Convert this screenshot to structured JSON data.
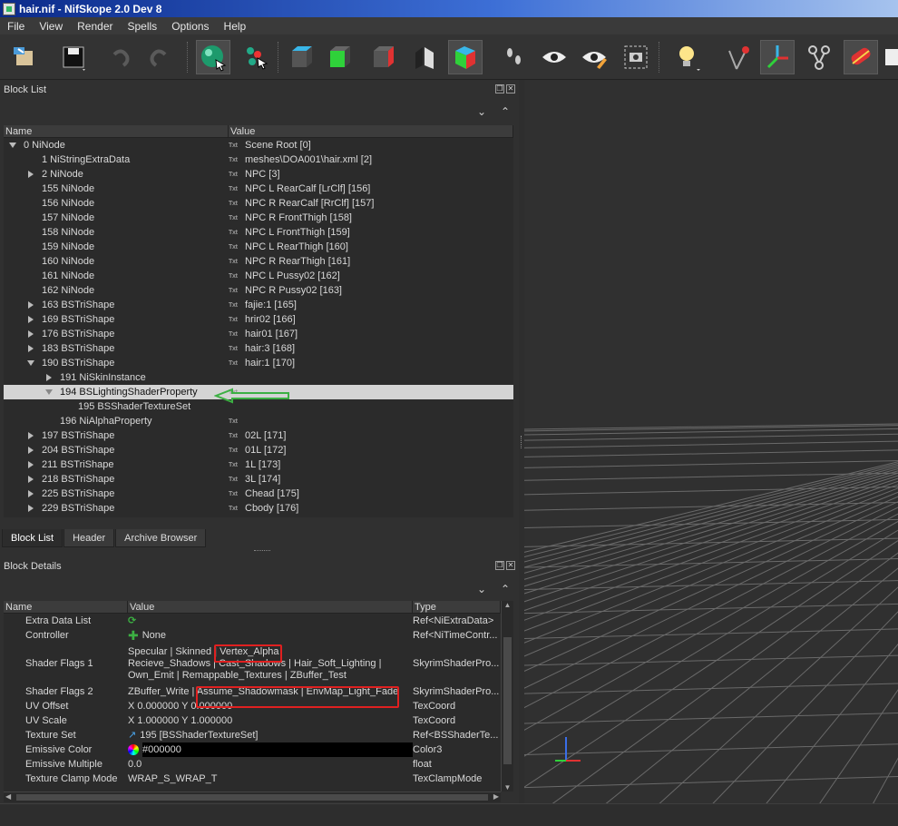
{
  "window": {
    "title": "hair.nif - NifSkope 2.0 Dev 8"
  },
  "menu": [
    "File",
    "View",
    "Render",
    "Spells",
    "Options",
    "Help"
  ],
  "block_list": {
    "title": "Block List",
    "columns": [
      "Name",
      "Value"
    ],
    "rows": [
      {
        "name": "0 NiNode",
        "value": "Scene Root [0]",
        "indent": 0,
        "arrow": "down"
      },
      {
        "name": "1 NiStringExtraData",
        "value": "meshes\\DOA001\\hair.xml [2]",
        "indent": 1,
        "arrow": ""
      },
      {
        "name": "2 NiNode",
        "value": "NPC [3]",
        "indent": 1,
        "arrow": "right"
      },
      {
        "name": "155 NiNode",
        "value": "NPC L RearCalf [LrClf] [156]",
        "indent": 1,
        "arrow": ""
      },
      {
        "name": "156 NiNode",
        "value": "NPC R RearCalf [RrClf] [157]",
        "indent": 1,
        "arrow": ""
      },
      {
        "name": "157 NiNode",
        "value": "NPC R FrontThigh [158]",
        "indent": 1,
        "arrow": ""
      },
      {
        "name": "158 NiNode",
        "value": "NPC L FrontThigh [159]",
        "indent": 1,
        "arrow": ""
      },
      {
        "name": "159 NiNode",
        "value": "NPC L RearThigh [160]",
        "indent": 1,
        "arrow": ""
      },
      {
        "name": "160 NiNode",
        "value": "NPC R RearThigh [161]",
        "indent": 1,
        "arrow": ""
      },
      {
        "name": "161 NiNode",
        "value": "NPC L Pussy02 [162]",
        "indent": 1,
        "arrow": ""
      },
      {
        "name": "162 NiNode",
        "value": "NPC R Pussy02 [163]",
        "indent": 1,
        "arrow": ""
      },
      {
        "name": "163 BSTriShape",
        "value": "fajie:1 [165]",
        "indent": 1,
        "arrow": "right"
      },
      {
        "name": "169 BSTriShape",
        "value": "hrir02 [166]",
        "indent": 1,
        "arrow": "right"
      },
      {
        "name": "176 BSTriShape",
        "value": "hair01 [167]",
        "indent": 1,
        "arrow": "right"
      },
      {
        "name": "183 BSTriShape",
        "value": "hair:3 [168]",
        "indent": 1,
        "arrow": "right"
      },
      {
        "name": "190 BSTriShape",
        "value": "hair:1 [170]",
        "indent": 1,
        "arrow": "down"
      },
      {
        "name": "191 NiSkinInstance",
        "value": "",
        "indent": 2,
        "arrow": "right"
      },
      {
        "name": "194 BSLightingShaderProperty",
        "value": "",
        "indent": 2,
        "arrow": "down",
        "selected": true
      },
      {
        "name": "195 BSShaderTextureSet",
        "value": "",
        "indent": 3,
        "arrow": ""
      },
      {
        "name": "196 NiAlphaProperty",
        "value": "",
        "indent": 2,
        "arrow": ""
      },
      {
        "name": "197 BSTriShape",
        "value": "02L [171]",
        "indent": 1,
        "arrow": "right"
      },
      {
        "name": "204 BSTriShape",
        "value": "01L [172]",
        "indent": 1,
        "arrow": "right"
      },
      {
        "name": "211 BSTriShape",
        "value": "1L [173]",
        "indent": 1,
        "arrow": "right"
      },
      {
        "name": "218 BSTriShape",
        "value": "3L [174]",
        "indent": 1,
        "arrow": "right"
      },
      {
        "name": "225 BSTriShape",
        "value": "Chead [175]",
        "indent": 1,
        "arrow": "right"
      },
      {
        "name": "229 BSTriShape",
        "value": "Cbody [176]",
        "indent": 1,
        "arrow": "right"
      }
    ]
  },
  "tabs": [
    "Block List",
    "Header",
    "Archive Browser"
  ],
  "block_details": {
    "title": "Block Details",
    "columns": [
      "Name",
      "Value",
      "Type"
    ],
    "rows": [
      {
        "name": "Extra Data List",
        "value": "",
        "type": "Ref<NiExtraData>",
        "icon": "link"
      },
      {
        "name": "Controller",
        "value": "None",
        "type": "Ref<NiTimeContr...",
        "icon": "plus"
      },
      {
        "name": "Shader Flags 1",
        "value_lines": [
          "Specular | Skinned | Vertex_Alpha",
          "Recieve_Shadows | Cast_Shadows | Hair_Soft_Lighting |",
          "Own_Emit | Remappable_Textures | ZBuffer_Test"
        ],
        "type": "SkyrimShaderPro..."
      },
      {
        "name": "Shader Flags 2",
        "value": "ZBuffer_Write | Assume_Shadowmask | EnvMap_Light_Fade",
        "type": "SkyrimShaderPro..."
      },
      {
        "name": "UV Offset",
        "value": "X 0.000000 Y 0.000000",
        "type": "TexCoord"
      },
      {
        "name": "UV Scale",
        "value": "X 1.000000 Y 1.000000",
        "type": "TexCoord"
      },
      {
        "name": "Texture Set",
        "value": "195 [BSShaderTextureSet]",
        "type": "Ref<BSShaderTe...",
        "icon": "ref"
      },
      {
        "name": "Emissive Color",
        "value": "#000000",
        "type": "Color3",
        "icon": "color"
      },
      {
        "name": "Emissive Multiple",
        "value": "0.0",
        "type": "float"
      },
      {
        "name": "Texture Clamp Mode",
        "value": "WRAP_S_WRAP_T",
        "type": "TexClampMode"
      }
    ]
  },
  "colors": {
    "highlight": "#e02020",
    "arrow": "#3cb043",
    "selected_row": "#d4d4d4"
  }
}
